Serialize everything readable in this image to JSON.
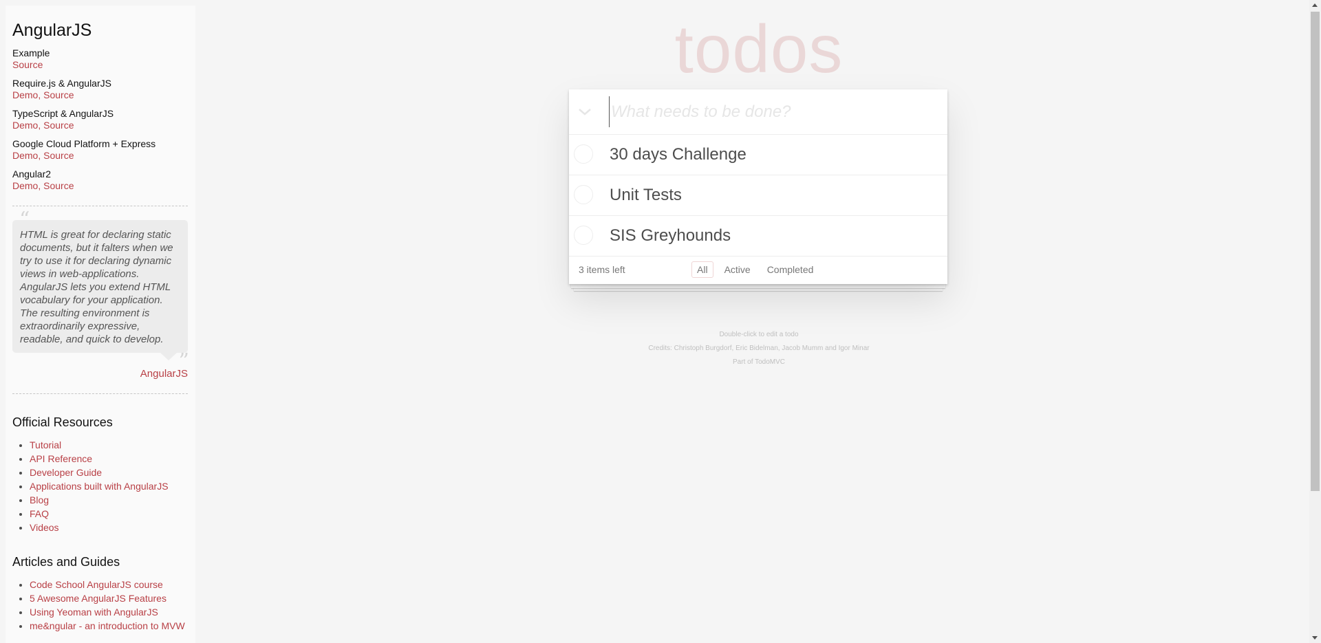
{
  "sidebar": {
    "title": "AngularJS",
    "examples": [
      {
        "name": "Example",
        "links": "Source"
      },
      {
        "name": "Require.js & AngularJS",
        "links": "Demo, Source"
      },
      {
        "name": "TypeScript & AngularJS",
        "links": "Demo, Source"
      },
      {
        "name": "Google Cloud Platform + Express",
        "links": "Demo, Source"
      },
      {
        "name": "Angular2",
        "links": "Demo, Source"
      }
    ],
    "quote": {
      "text": "HTML is great for declaring static documents, but it falters when we try to use it for declaring dynamic views in web-applications. AngularJS lets you extend HTML vocabulary for your application. The resulting environment is extraordinarily expressive, readable, and quick to develop.",
      "open_mark": "“",
      "close_mark": "”",
      "source": "AngularJS"
    },
    "official_resources": {
      "heading": "Official Resources",
      "items": [
        "Tutorial",
        "API Reference",
        "Developer Guide",
        "Applications built with AngularJS",
        "Blog",
        "FAQ",
        "Videos"
      ]
    },
    "articles": {
      "heading": "Articles and Guides",
      "items": [
        "Code School AngularJS course",
        "5 Awesome AngularJS Features",
        "Using Yeoman with AngularJS",
        "me&ngular - an introduction to MVW"
      ]
    }
  },
  "app": {
    "title": "todos",
    "new_todo_placeholder": "What needs to be done?",
    "new_todo_value": "",
    "todos": [
      {
        "title": "30 days Challenge",
        "completed": false
      },
      {
        "title": "Unit Tests",
        "completed": false
      },
      {
        "title": "SIS Greyhounds",
        "completed": false
      }
    ],
    "footer": {
      "count": "3 items left",
      "filters": [
        "All",
        "Active",
        "Completed"
      ],
      "selected_filter": "All"
    },
    "info": [
      "Double-click to edit a todo",
      "Credits: Christoph Burgdorf, Eric Bidelman, Jacob Mumm and Igor Minar",
      "Part of TodoMVC"
    ]
  },
  "colors": {
    "accent": "#b83f45",
    "title": "rgba(175,47,47,0.15)",
    "background": "#f5f5f5"
  }
}
